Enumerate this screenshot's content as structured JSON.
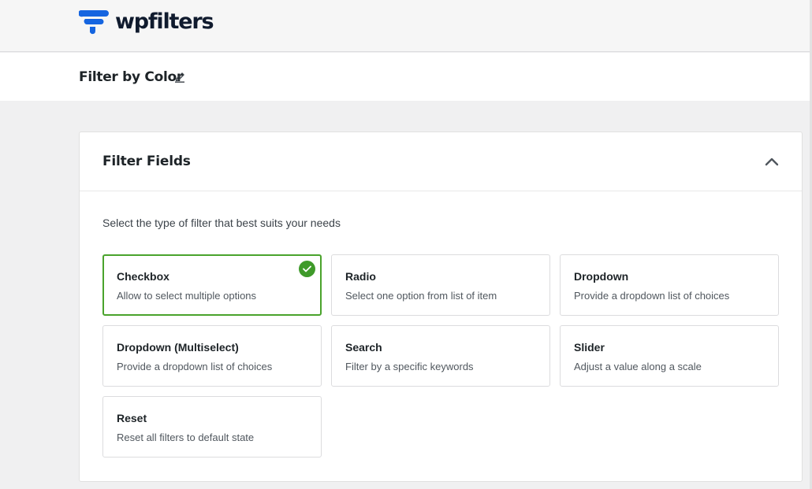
{
  "brand": {
    "name": "wpfilters",
    "color": "#1565e0"
  },
  "page": {
    "title": "Filter by Color"
  },
  "panel": {
    "title": "Filter Fields",
    "intro": "Select the type of filter that best suits your needs"
  },
  "filter_types": [
    {
      "title": "Checkbox",
      "desc": "Allow to select multiple options",
      "selected": true
    },
    {
      "title": "Radio",
      "desc": "Select one option from list of item",
      "selected": false
    },
    {
      "title": "Dropdown",
      "desc": "Provide a dropdown list of choices",
      "selected": false
    },
    {
      "title": "Dropdown (Multiselect)",
      "desc": "Provide a dropdown list of choices",
      "selected": false
    },
    {
      "title": "Search",
      "desc": "Filter by a specific keywords",
      "selected": false
    },
    {
      "title": "Slider",
      "desc": "Adjust a value along a scale",
      "selected": false
    },
    {
      "title": "Reset",
      "desc": "Reset all filters to default state",
      "selected": false
    }
  ],
  "colors": {
    "selected_border": "#4aa32c",
    "check_bg": "#3f9a2a"
  },
  "icons": {
    "edit": "pencil-icon",
    "collapse": "chevron-up-icon",
    "selected": "checkmark-icon"
  }
}
